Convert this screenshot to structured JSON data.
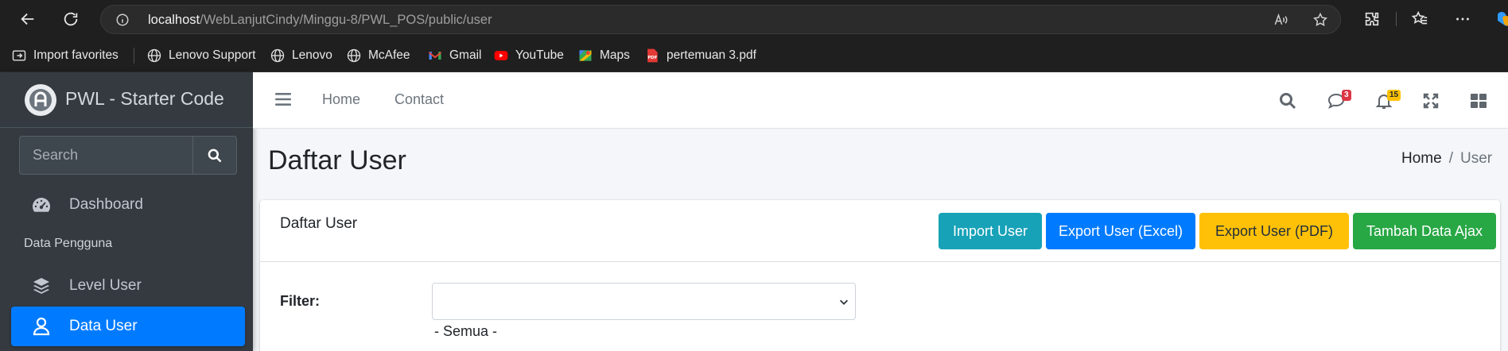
{
  "browser": {
    "url_host": "localhost",
    "url_path": "/WebLanjutCindy/Minggu-8/PWL_POS/public/user",
    "bookmarks": [
      {
        "label": "Import favorites",
        "icon": "import-icon"
      },
      {
        "label": "Lenovo Support",
        "icon": "globe-icon"
      },
      {
        "label": "Lenovo",
        "icon": "globe-icon"
      },
      {
        "label": "McAfee",
        "icon": "globe-icon"
      },
      {
        "label": "Gmail",
        "icon": "gmail-icon"
      },
      {
        "label": "YouTube",
        "icon": "youtube-icon"
      },
      {
        "label": "Maps",
        "icon": "maps-icon"
      },
      {
        "label": "pertemuan 3.pdf",
        "icon": "pdf-icon"
      }
    ]
  },
  "sidebar": {
    "brand": "PWL - Starter Code",
    "search_placeholder": "Search",
    "items": [
      {
        "label": "Dashboard",
        "icon": "tachometer-icon",
        "active": false
      },
      {
        "label": "Level User",
        "icon": "layers-icon",
        "active": false
      },
      {
        "label": "Data User",
        "icon": "user-icon",
        "active": true
      }
    ],
    "section_header": "Data Pengguna"
  },
  "navbar": {
    "links": [
      "Home",
      "Contact"
    ],
    "messages_badge": "3",
    "notifications_badge": "15"
  },
  "content": {
    "page_title": "Daftar User",
    "breadcrumb": {
      "home": "Home",
      "separator": "/",
      "current": "User"
    },
    "card": {
      "title": "Daftar User",
      "buttons": {
        "import": "Import User",
        "export_excel": "Export User (Excel)",
        "export_pdf": "Export User (PDF)",
        "add_ajax": "Tambah Data Ajax"
      },
      "filter_label": "Filter:",
      "filter_value": "",
      "filter_help": "- Semua -"
    }
  },
  "colors": {
    "primary": "#007bff",
    "info": "#17a2b8",
    "warning": "#ffc107",
    "success": "#28a745",
    "danger": "#dc3545",
    "sidebar_bg": "#343a40"
  }
}
